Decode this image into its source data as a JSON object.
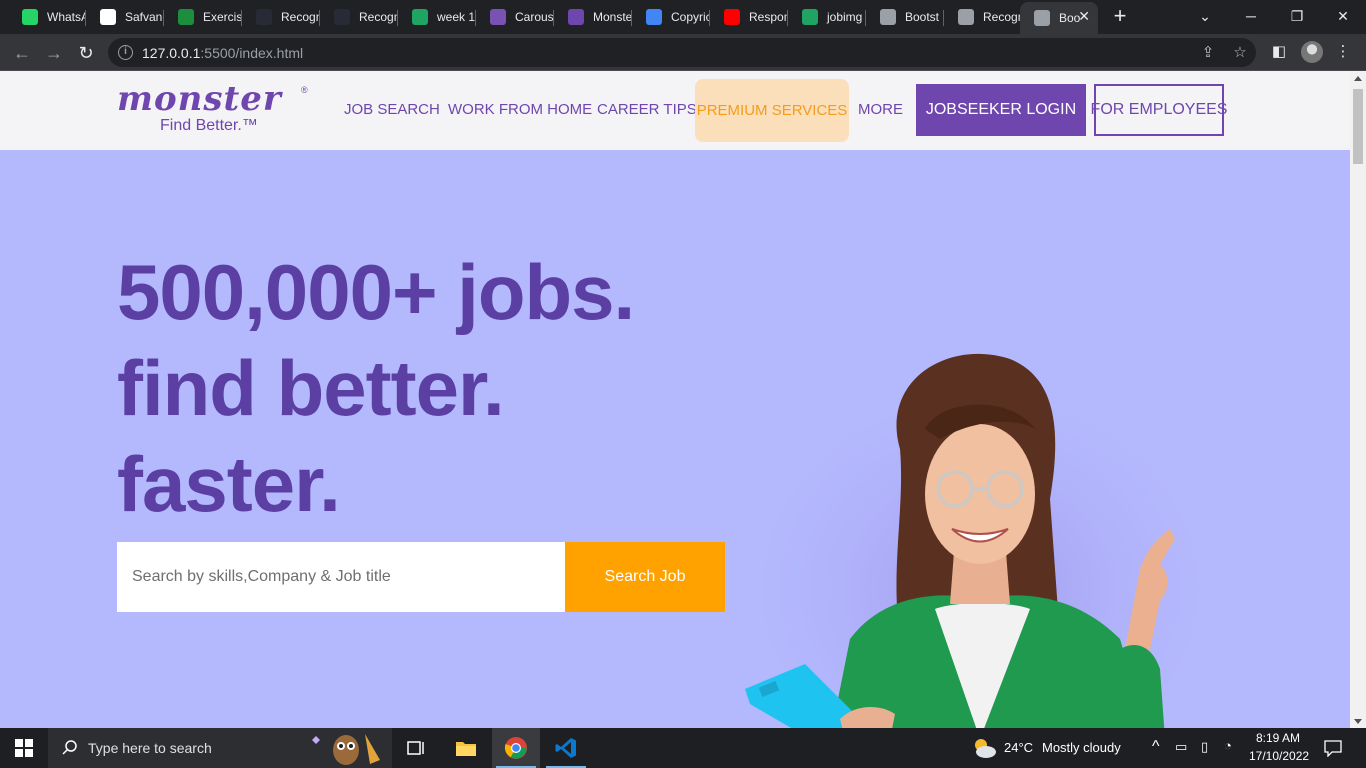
{
  "browser": {
    "tabs": [
      {
        "label": "WhatsA",
        "icon": "whatsapp-icon",
        "color": "#25d366"
      },
      {
        "label": "Safvan",
        "icon": "github-icon",
        "color": "#ffffff"
      },
      {
        "label": "Exercis",
        "icon": "w3-icon",
        "color": "#1d8e3e"
      },
      {
        "label": "Recogn",
        "icon": "w3schools-icon",
        "color": "#282a35"
      },
      {
        "label": "Recogn",
        "icon": "w3schools-icon",
        "color": "#282a35"
      },
      {
        "label": "week 1",
        "icon": "google-drive-icon",
        "color": "#1fa463"
      },
      {
        "label": "Carous",
        "icon": "bootstrap-icon",
        "color": "#7952b3"
      },
      {
        "label": "Monste",
        "icon": "monster-icon",
        "color": "#6e46ae"
      },
      {
        "label": "Copyric",
        "icon": "google-icon",
        "color": "#4285f4"
      },
      {
        "label": "Respon",
        "icon": "youtube-icon",
        "color": "#ff0000"
      },
      {
        "label": "jobimg",
        "icon": "google-drive-icon",
        "color": "#1fa463"
      },
      {
        "label": "Bootst",
        "icon": "globe-icon",
        "color": "#9aa0a6"
      },
      {
        "label": "Recogn",
        "icon": "globe-icon",
        "color": "#9aa0a6"
      },
      {
        "label": "Boo",
        "icon": "globe-icon",
        "color": "#9aa0a6",
        "active": true
      }
    ],
    "url_host": "127.0.0.1",
    "url_rest": ":5500/index.html"
  },
  "site": {
    "logo_word": "monster",
    "logo_reg": "®",
    "logo_tag": "Find Better.™",
    "nav": {
      "job_search": "JOB SEARCH",
      "work_from_home": "WORK FROM HOME",
      "career_tips": "CAREER TIPS",
      "premium_services": "PREMIUM SERVICES",
      "more": "MORE"
    },
    "login_label": "JOBSEEKER LOGIN",
    "employees_label": "FOR EMPLOYEES",
    "hero": {
      "line1": "500,000+ jobs.",
      "line2": "find better.",
      "line3": "faster."
    },
    "search": {
      "placeholder": "Search by skills,Company & Job title",
      "button": "Search Job"
    },
    "colors": {
      "brand_purple": "#6e46ae",
      "hero_bg": "#b4b8fd",
      "accent_orange": "#ffa200",
      "premium_bg": "#fbdfba"
    }
  },
  "taskbar": {
    "search_placeholder": "Type here to search",
    "weather_temp": "24°C",
    "weather_desc": "Mostly cloudy",
    "time": "8:19 AM",
    "date": "17/10/2022"
  }
}
